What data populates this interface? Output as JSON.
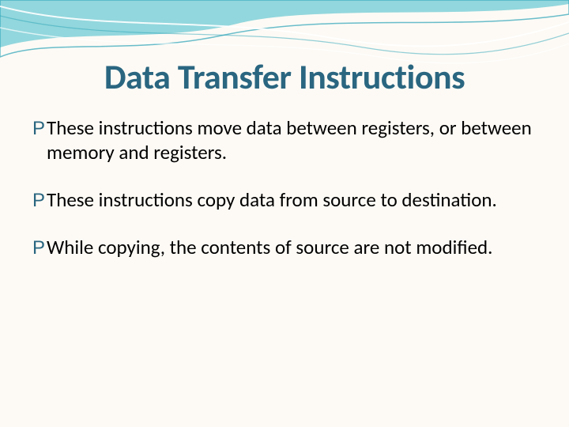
{
  "title": "Data Transfer Instructions",
  "bullets": {
    "b0": "These instructions move data between registers, or between memory and registers.",
    "b1": "These instructions copy data from source to destination.",
    "b2": "While copying, the contents of source are not modified."
  },
  "bullet_glyph": "P"
}
